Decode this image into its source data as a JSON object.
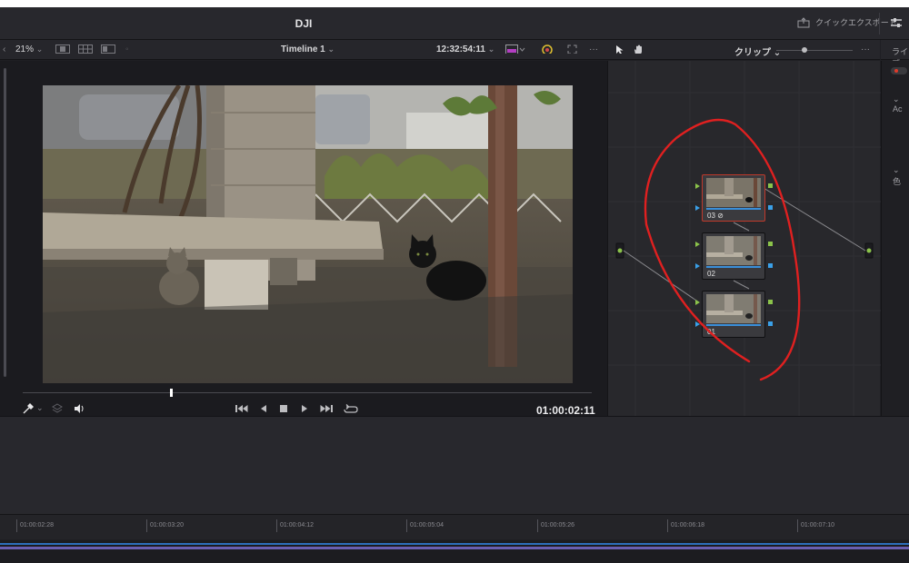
{
  "app": {
    "title": "DJI",
    "quick_export": "クイックエクスポート"
  },
  "viewer_toolbar": {
    "zoom": "21%",
    "timeline_name": "Timeline 1",
    "source_timecode": "12:32:54:11"
  },
  "node_toolbar": {
    "mode": "クリップ"
  },
  "right_panel": {
    "header": "ライブ",
    "item_a": "Ac",
    "item_b": "色"
  },
  "viewer": {
    "timecode": "01:00:02:11",
    "playhead_position": 0.26
  },
  "nodes": [
    {
      "label": "03",
      "selected": true
    },
    {
      "label": "02",
      "selected": false
    },
    {
      "label": "01",
      "selected": false
    }
  ],
  "ruler": {
    "ticks": [
      "01:00:02:28",
      "01:00:03:20",
      "01:00:04:12",
      "01:00:05:04",
      "01:00:05:26",
      "01:00:06:18",
      "01:00:07:10"
    ]
  },
  "colors": {
    "accent_selection": "#c0392b",
    "node_bar": "#3a8fd9",
    "annotation": "#e02020"
  }
}
